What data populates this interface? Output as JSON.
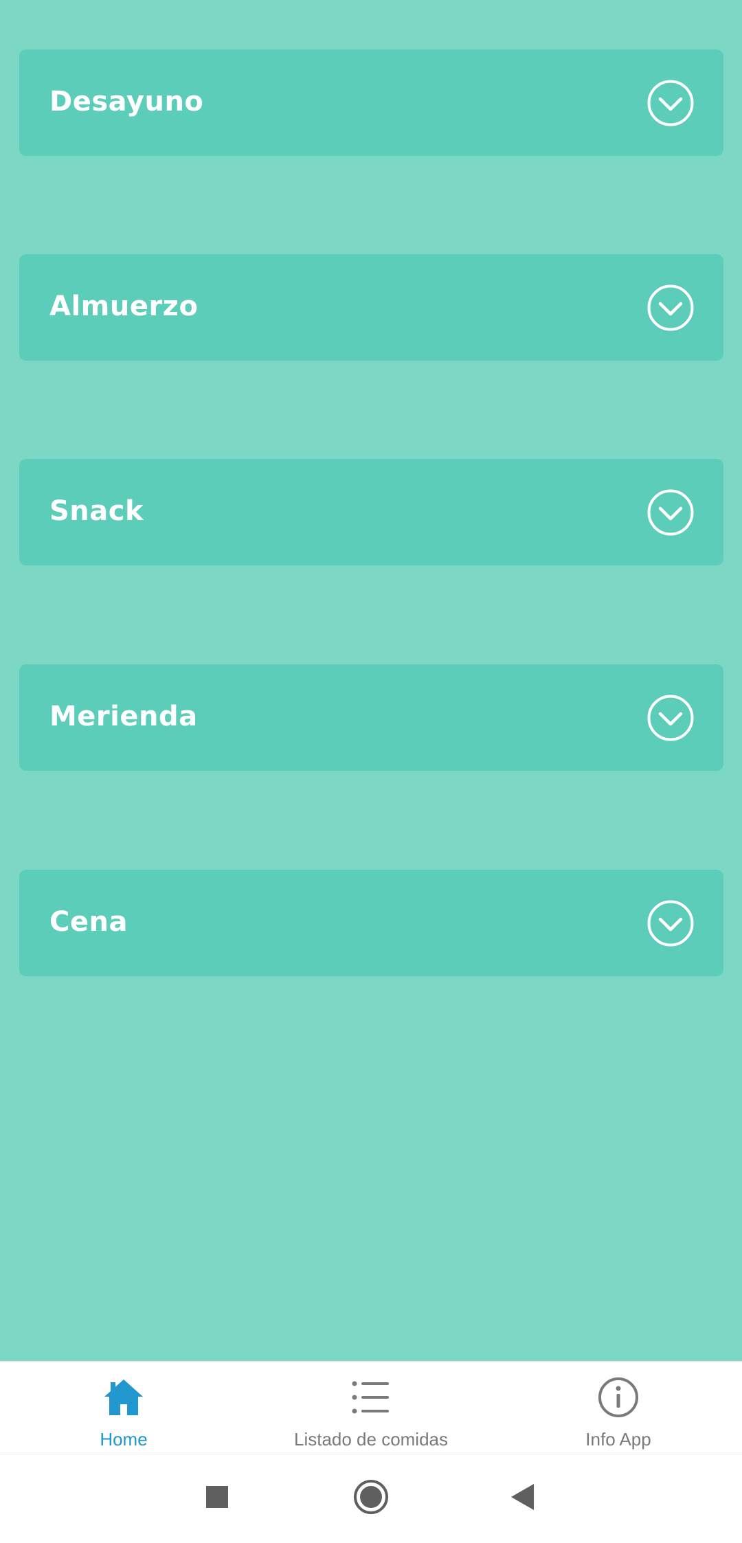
{
  "meals": [
    {
      "label": "Desayuno",
      "icon": "chevron-down-circle-icon"
    },
    {
      "label": "Almuerzo",
      "icon": "chevron-down-circle-icon"
    },
    {
      "label": "Snack",
      "icon": "chevron-down-circle-icon"
    },
    {
      "label": "Merienda",
      "icon": "chevron-down-circle-icon"
    },
    {
      "label": "Cena",
      "icon": "chevron-down-circle-icon"
    }
  ],
  "bottom_nav": {
    "items": [
      {
        "label": "Home",
        "icon": "home-icon",
        "active": true
      },
      {
        "label": "Listado de comidas",
        "icon": "list-icon",
        "active": false
      },
      {
        "label": "Info App",
        "icon": "info-icon",
        "active": false
      }
    ]
  },
  "system_nav": {
    "items": [
      {
        "icon": "recents-square-icon"
      },
      {
        "icon": "home-circle-icon"
      },
      {
        "icon": "back-triangle-icon"
      }
    ]
  },
  "colors": {
    "background": "#7dd7c5",
    "card": "#5bcdb8",
    "card_text": "#ffffff",
    "nav_active": "#2196cf",
    "nav_inactive": "#7a7a7a",
    "system_icons": "#5f5f5f"
  }
}
